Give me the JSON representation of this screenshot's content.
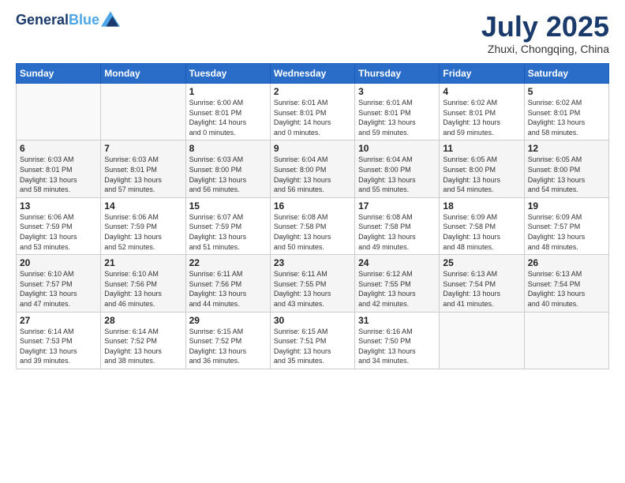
{
  "header": {
    "logo_line1": "General",
    "logo_line2": "Blue",
    "month": "July 2025",
    "location": "Zhuxi, Chongqing, China"
  },
  "weekdays": [
    "Sunday",
    "Monday",
    "Tuesday",
    "Wednesday",
    "Thursday",
    "Friday",
    "Saturday"
  ],
  "weeks": [
    [
      {
        "day": "",
        "info": ""
      },
      {
        "day": "",
        "info": ""
      },
      {
        "day": "1",
        "info": "Sunrise: 6:00 AM\nSunset: 8:01 PM\nDaylight: 14 hours\nand 0 minutes."
      },
      {
        "day": "2",
        "info": "Sunrise: 6:01 AM\nSunset: 8:01 PM\nDaylight: 14 hours\nand 0 minutes."
      },
      {
        "day": "3",
        "info": "Sunrise: 6:01 AM\nSunset: 8:01 PM\nDaylight: 13 hours\nand 59 minutes."
      },
      {
        "day": "4",
        "info": "Sunrise: 6:02 AM\nSunset: 8:01 PM\nDaylight: 13 hours\nand 59 minutes."
      },
      {
        "day": "5",
        "info": "Sunrise: 6:02 AM\nSunset: 8:01 PM\nDaylight: 13 hours\nand 58 minutes."
      }
    ],
    [
      {
        "day": "6",
        "info": "Sunrise: 6:03 AM\nSunset: 8:01 PM\nDaylight: 13 hours\nand 58 minutes."
      },
      {
        "day": "7",
        "info": "Sunrise: 6:03 AM\nSunset: 8:01 PM\nDaylight: 13 hours\nand 57 minutes."
      },
      {
        "day": "8",
        "info": "Sunrise: 6:03 AM\nSunset: 8:00 PM\nDaylight: 13 hours\nand 56 minutes."
      },
      {
        "day": "9",
        "info": "Sunrise: 6:04 AM\nSunset: 8:00 PM\nDaylight: 13 hours\nand 56 minutes."
      },
      {
        "day": "10",
        "info": "Sunrise: 6:04 AM\nSunset: 8:00 PM\nDaylight: 13 hours\nand 55 minutes."
      },
      {
        "day": "11",
        "info": "Sunrise: 6:05 AM\nSunset: 8:00 PM\nDaylight: 13 hours\nand 54 minutes."
      },
      {
        "day": "12",
        "info": "Sunrise: 6:05 AM\nSunset: 8:00 PM\nDaylight: 13 hours\nand 54 minutes."
      }
    ],
    [
      {
        "day": "13",
        "info": "Sunrise: 6:06 AM\nSunset: 7:59 PM\nDaylight: 13 hours\nand 53 minutes."
      },
      {
        "day": "14",
        "info": "Sunrise: 6:06 AM\nSunset: 7:59 PM\nDaylight: 13 hours\nand 52 minutes."
      },
      {
        "day": "15",
        "info": "Sunrise: 6:07 AM\nSunset: 7:59 PM\nDaylight: 13 hours\nand 51 minutes."
      },
      {
        "day": "16",
        "info": "Sunrise: 6:08 AM\nSunset: 7:58 PM\nDaylight: 13 hours\nand 50 minutes."
      },
      {
        "day": "17",
        "info": "Sunrise: 6:08 AM\nSunset: 7:58 PM\nDaylight: 13 hours\nand 49 minutes."
      },
      {
        "day": "18",
        "info": "Sunrise: 6:09 AM\nSunset: 7:58 PM\nDaylight: 13 hours\nand 48 minutes."
      },
      {
        "day": "19",
        "info": "Sunrise: 6:09 AM\nSunset: 7:57 PM\nDaylight: 13 hours\nand 48 minutes."
      }
    ],
    [
      {
        "day": "20",
        "info": "Sunrise: 6:10 AM\nSunset: 7:57 PM\nDaylight: 13 hours\nand 47 minutes."
      },
      {
        "day": "21",
        "info": "Sunrise: 6:10 AM\nSunset: 7:56 PM\nDaylight: 13 hours\nand 46 minutes."
      },
      {
        "day": "22",
        "info": "Sunrise: 6:11 AM\nSunset: 7:56 PM\nDaylight: 13 hours\nand 44 minutes."
      },
      {
        "day": "23",
        "info": "Sunrise: 6:11 AM\nSunset: 7:55 PM\nDaylight: 13 hours\nand 43 minutes."
      },
      {
        "day": "24",
        "info": "Sunrise: 6:12 AM\nSunset: 7:55 PM\nDaylight: 13 hours\nand 42 minutes."
      },
      {
        "day": "25",
        "info": "Sunrise: 6:13 AM\nSunset: 7:54 PM\nDaylight: 13 hours\nand 41 minutes."
      },
      {
        "day": "26",
        "info": "Sunrise: 6:13 AM\nSunset: 7:54 PM\nDaylight: 13 hours\nand 40 minutes."
      }
    ],
    [
      {
        "day": "27",
        "info": "Sunrise: 6:14 AM\nSunset: 7:53 PM\nDaylight: 13 hours\nand 39 minutes."
      },
      {
        "day": "28",
        "info": "Sunrise: 6:14 AM\nSunset: 7:52 PM\nDaylight: 13 hours\nand 38 minutes."
      },
      {
        "day": "29",
        "info": "Sunrise: 6:15 AM\nSunset: 7:52 PM\nDaylight: 13 hours\nand 36 minutes."
      },
      {
        "day": "30",
        "info": "Sunrise: 6:15 AM\nSunset: 7:51 PM\nDaylight: 13 hours\nand 35 minutes."
      },
      {
        "day": "31",
        "info": "Sunrise: 6:16 AM\nSunset: 7:50 PM\nDaylight: 13 hours\nand 34 minutes."
      },
      {
        "day": "",
        "info": ""
      },
      {
        "day": "",
        "info": ""
      }
    ]
  ]
}
